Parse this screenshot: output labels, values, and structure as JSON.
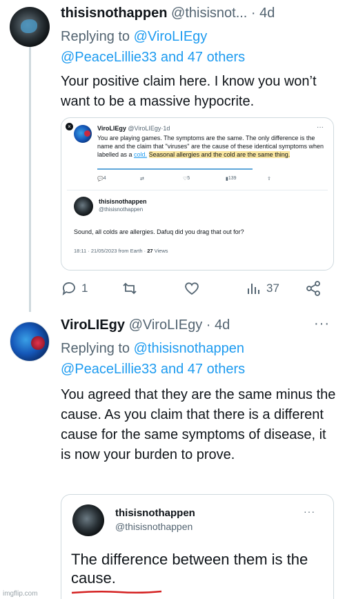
{
  "tweet1": {
    "name": "thisisnothappen",
    "handle": "@thisisnot...",
    "dot": "·",
    "age": "4d",
    "replying_prefix": "Replying to ",
    "replying_user": "@ViroLIEgy",
    "replying_others": "@PeaceLillie33 and 47 others",
    "text": "Your positive claim here. I know you won’t want to be a massive hypocrite.",
    "embed": {
      "close": "×",
      "name": "ViroLIEgy",
      "handle": "@ViroLIEgy",
      "dot": "·",
      "age": "1d",
      "more": "···",
      "text_part1": "You are playing games. The symptoms are the same. The only difference is the name and the claim that \"viruses\" are the cause of these identical symptoms when labelled as a ",
      "text_cold": "cold.",
      "text_part2": "Seasonal allergies and the cold are the same thing.",
      "replies": "4",
      "retweets": "",
      "likes": "5",
      "views": "139",
      "reply_name": "thisisnothappen",
      "reply_handle": "@thisisnothappen",
      "reply_text": "Sound, all colds are allergies. Dafuq did you drag that out for?",
      "meta_time": "18:11 · 21/05/2023 from Earth ·",
      "meta_views": "27",
      "meta_views_label": "Views"
    },
    "actions": {
      "replies": "1",
      "retweets": "",
      "likes": "",
      "views": "37"
    }
  },
  "tweet2": {
    "name": "ViroLIEgy",
    "handle": "@ViroLIEgy",
    "dot": "·",
    "age": "4d",
    "more": "···",
    "replying_prefix": "Replying to ",
    "replying_user": "@thisisnothappen",
    "replying_others": "@PeaceLillie33 and 47 others",
    "text": "You agreed that they are the same minus the cause. As you claim that there is a different cause for the same symptoms of disease, it is now your burden to prove.",
    "embed": {
      "name": "thisisnothappen",
      "handle": "@thisisnothappen",
      "more": "···",
      "text": "The difference between them is the cause."
    }
  },
  "watermark": "imgflip.com",
  "colors": {
    "link": "#1d9bf0",
    "muted": "#536471",
    "text": "#0f1419",
    "highlight": "#fbe7a1",
    "underline_red": "#d42020"
  }
}
